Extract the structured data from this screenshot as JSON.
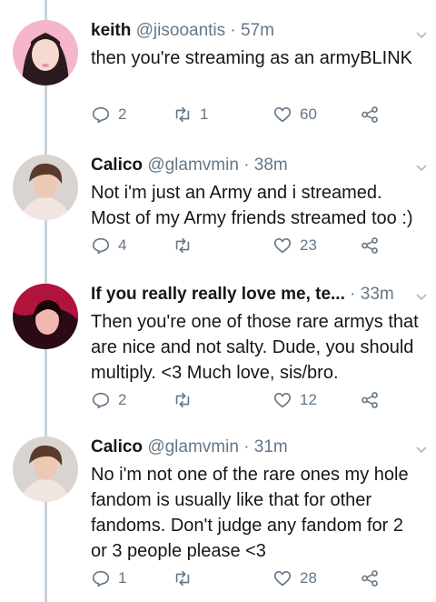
{
  "tweets": [
    {
      "name": "keith",
      "handle": "@jisooantis",
      "dot": "·",
      "time": "57m",
      "text": "then you're streaming as an armyBLINK",
      "replies": "2",
      "retweets": "1",
      "likes": "60",
      "avatar_colors": [
        "#f4b6c8",
        "#e88fae",
        "#2a1a1e"
      ]
    },
    {
      "name": "Calico",
      "handle": "@glamvmin",
      "dot": "·",
      "time": "38m",
      "text": "Not i'm just an Army and i streamed. Most of my Army friends streamed too :)",
      "replies": "4",
      "retweets": "",
      "likes": "23",
      "avatar_colors": [
        "#d9d4d0",
        "#5a3a2a",
        "#f1e6df"
      ]
    },
    {
      "name": "If you really really love me, te...",
      "handle": "",
      "dot": "·",
      "time": "33m",
      "text": "Then you're one of those rare armys that are nice and not salty. Dude, you should multiply. <3 Much love, sis/bro.",
      "replies": "2",
      "retweets": "",
      "likes": "12",
      "avatar_colors": [
        "#b0143c",
        "#2a0a14",
        "#f0b8b0"
      ]
    },
    {
      "name": "Calico",
      "handle": "@glamvmin",
      "dot": "·",
      "time": "31m",
      "text": "No i'm not one of the rare ones my hole fandom is usually like that for other fandoms. Don't judge any fandom for 2 or 3 people please <3",
      "replies": "1",
      "retweets": "",
      "likes": "28",
      "avatar_colors": [
        "#d9d4d0",
        "#5a3a2a",
        "#f1e6df"
      ]
    }
  ],
  "icons": {
    "reply": "reply-icon",
    "retweet": "retweet-icon",
    "like": "heart-icon",
    "share": "share-icon",
    "more": "chevron-down-icon"
  },
  "colors": {
    "text": "#14171a",
    "secondary": "#657786",
    "thread_line": "#c8d3dc"
  }
}
